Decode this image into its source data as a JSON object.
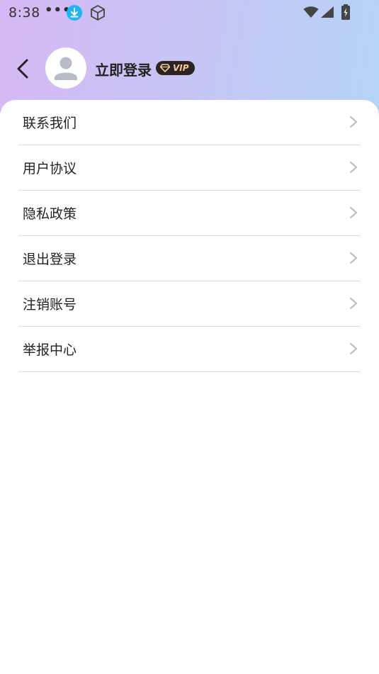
{
  "status_bar": {
    "time": "8:38",
    "more_dots": "•••",
    "icons": [
      "download-icon",
      "cube-icon",
      "wifi-icon",
      "signal-icon",
      "battery-icon"
    ]
  },
  "header": {
    "login_label": "立即登录",
    "vip_label": "VIP",
    "gradient_colors": [
      "#d6b8f5",
      "#b5d3f6"
    ]
  },
  "menu": {
    "items": [
      {
        "label": "联系我们"
      },
      {
        "label": "用户协议"
      },
      {
        "label": "隐私政策"
      },
      {
        "label": "退出登录"
      },
      {
        "label": "注销账号"
      },
      {
        "label": "举报中心"
      }
    ]
  }
}
